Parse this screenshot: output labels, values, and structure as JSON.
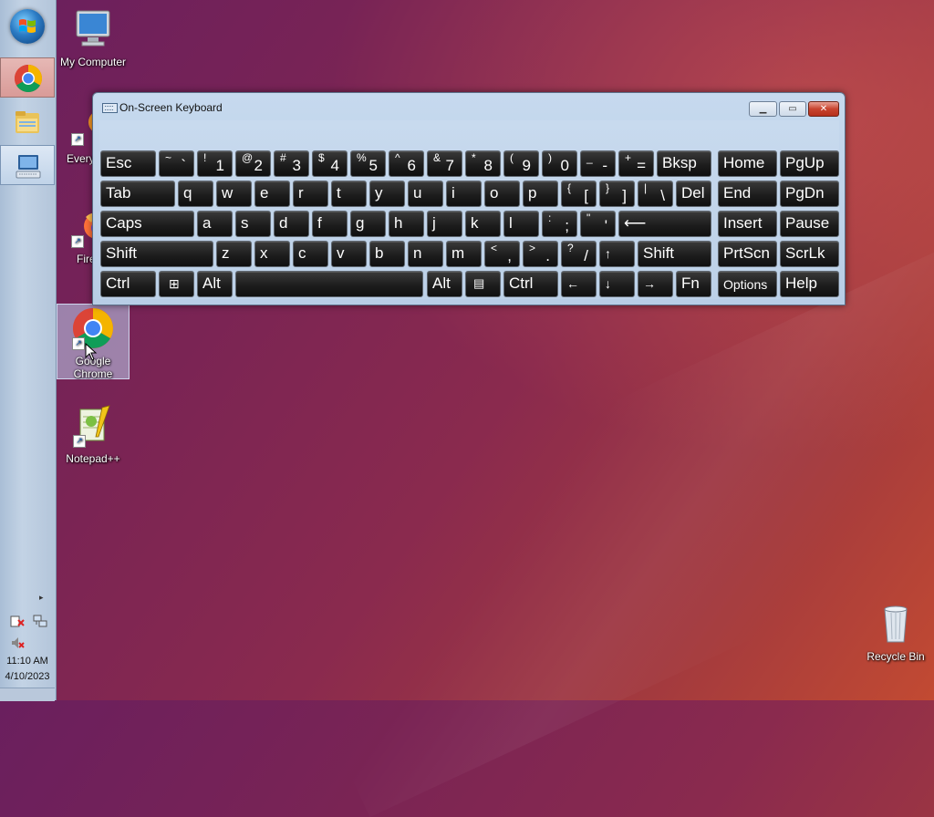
{
  "desktop": {
    "icons": [
      {
        "label": "My Computer"
      },
      {
        "label": "Every"
      },
      {
        "label": "Fire"
      },
      {
        "label_line1": "Google",
        "label_line2": "Chrome"
      },
      {
        "label": "Notepad++"
      },
      {
        "label": "Recycle Bin"
      }
    ]
  },
  "taskbar": {
    "clock_time": "11:10 AM",
    "clock_date": "4/10/2023",
    "tray_expand": "▸"
  },
  "osk": {
    "title": "On-Screen Keyboard",
    "buttons": {
      "min": "▁",
      "max": "▭",
      "close": "✕"
    },
    "keys": {
      "esc": "Esc",
      "bksp": "Bksp",
      "home": "Home",
      "pgup": "PgUp",
      "tab": "Tab",
      "del": "Del",
      "end": "End",
      "pgdn": "PgDn",
      "caps": "Caps",
      "insert": "Insert",
      "pause": "Pause",
      "shift_l": "Shift",
      "shift_r": "Shift",
      "prtscn": "PrtScn",
      "scrlk": "ScrLk",
      "ctrl_l": "Ctrl",
      "alt_l": "Alt",
      "alt_r": "Alt",
      "ctrl_r": "Ctrl",
      "fn": "Fn",
      "options": "Options",
      "help": "Help",
      "enter_arrow": "⟵",
      "up": "↑",
      "down": "↓",
      "left": "←",
      "right": "→",
      "win": "⊞",
      "menu": "▤"
    },
    "row1": [
      {
        "s": "~",
        "b": "`"
      },
      {
        "s": "!",
        "b": "1"
      },
      {
        "s": "@",
        "b": "2"
      },
      {
        "s": "#",
        "b": "3"
      },
      {
        "s": "$",
        "b": "4"
      },
      {
        "s": "%",
        "b": "5"
      },
      {
        "s": "^",
        "b": "6"
      },
      {
        "s": "&",
        "b": "7"
      },
      {
        "s": "*",
        "b": "8"
      },
      {
        "s": "(",
        "b": "9"
      },
      {
        "s": ")",
        "b": "0"
      },
      {
        "s": "_",
        "b": "-"
      },
      {
        "s": "+",
        "b": "="
      }
    ],
    "row2": [
      "q",
      "w",
      "e",
      "r",
      "t",
      "y",
      "u",
      "i",
      "o",
      "p"
    ],
    "row2_sym": [
      {
        "s": "{",
        "b": "["
      },
      {
        "s": "}",
        "b": "]"
      },
      {
        "s": "|",
        "b": "\\"
      }
    ],
    "row3": [
      "a",
      "s",
      "d",
      "f",
      "g",
      "h",
      "j",
      "k",
      "l"
    ],
    "row3_sym": [
      {
        "s": ":",
        "b": ";"
      },
      {
        "s": "\"",
        "b": "'"
      }
    ],
    "row4": [
      "z",
      "x",
      "c",
      "v",
      "b",
      "n",
      "m"
    ],
    "row4_sym": [
      {
        "s": "<",
        "b": ","
      },
      {
        "s": ">",
        "b": "."
      },
      {
        "s": "?",
        "b": "/"
      }
    ]
  }
}
